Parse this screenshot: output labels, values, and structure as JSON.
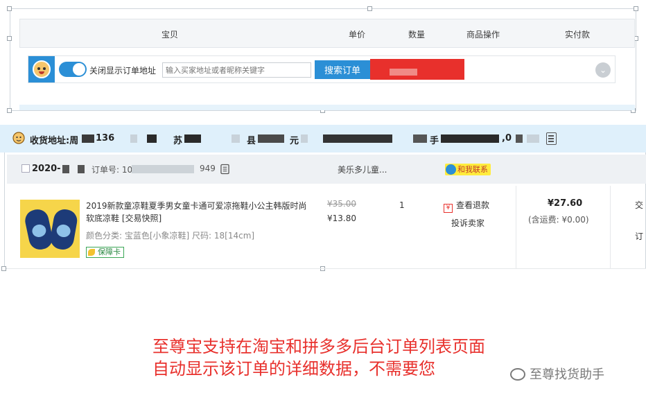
{
  "header": {
    "columns": [
      "宝贝",
      "单价",
      "数量",
      "商品操作",
      "实付款"
    ]
  },
  "toolbar": {
    "toggle_label": "关闭显示订单地址",
    "search_placeholder": "输入买家地址或者昵称关键字",
    "search_button": "搜索订单"
  },
  "address": {
    "label": "收货地址:周",
    "visible_fragments": [
      "136",
      "苏",
      "县",
      "元",
      "手",
      ",0"
    ]
  },
  "order": {
    "date": "2020-",
    "number_label": "订单号: 10",
    "number_tail": "949",
    "shop_name": "美乐多儿童...",
    "contact_label": "和我联系"
  },
  "product": {
    "title": "2019新款童凉鞋夏季男女童卡通可爱凉拖鞋小公主韩版时尚软底凉鞋 [交易快照]",
    "sku": "颜色分类: 宝蓝色[小象凉鞋]   尺码: 18[14cm]",
    "guarantee_label": "保障卡",
    "price_original": "¥35.00",
    "price_current": "¥13.80",
    "quantity": "1",
    "op_refund": "查看退款",
    "op_complain": "投诉卖家",
    "paid_amount": "¥27.60",
    "paid_shipping": "(含运费: ¥0.00)",
    "trade_status_1": "交",
    "trade_status_2": "订"
  },
  "caption": {
    "line1": "至尊宝支持在淘宝和拼多多后台订单列表页面",
    "line2": "自动显示该订单的详细数据，不需要您"
  },
  "watermark": "至尊找货助手",
  "colors": {
    "accent": "#2b8fd6",
    "caption_red": "#e8302c",
    "address_bg": "#dff0fb"
  }
}
